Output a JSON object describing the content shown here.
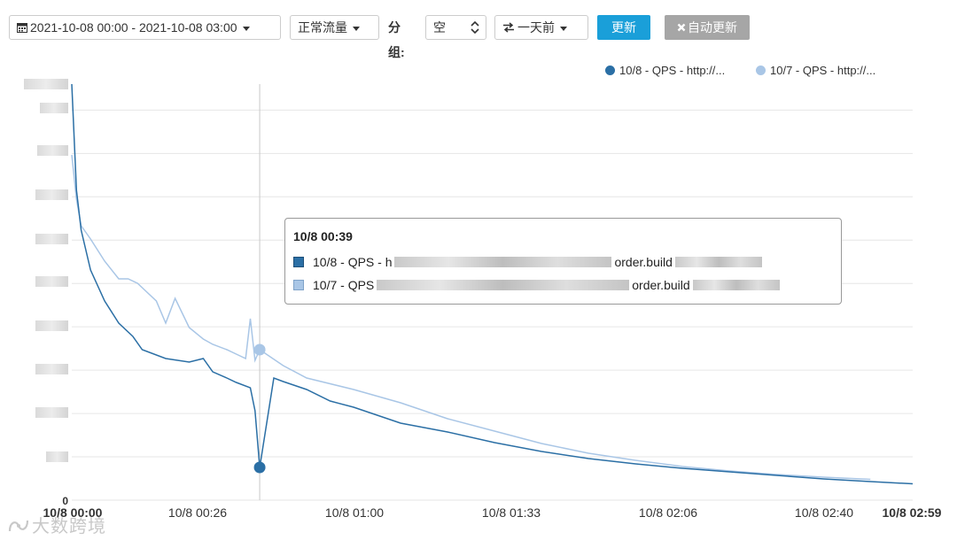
{
  "toolbar": {
    "date_range": "2021-10-08 00:00 - 2021-10-08 03:00",
    "traffic": "正常流量",
    "group_label": "分组:",
    "group_value": "空",
    "compare": "一天前",
    "update": "更新",
    "auto_update": "自动更新"
  },
  "icons": {
    "calendar": "calendar-icon",
    "swap": "swap-arrows-icon",
    "close": "close-icon",
    "select": "select-arrows-icon"
  },
  "colors": {
    "series_today": "#2b6fa5",
    "series_yesterday": "#a9c6e6",
    "button_primary": "#1a9fd9",
    "button_disabled": "#a6a6a6"
  },
  "watermark": "大数跨境",
  "tooltip": {
    "title": "10/8 00:39",
    "rows": [
      {
        "prefix": "10/8 - QPS - h",
        "suffix": "order.build"
      },
      {
        "prefix": "10/7 - QPS",
        "suffix": "order.build"
      }
    ]
  },
  "chart_data": {
    "type": "line",
    "legend_position": "top-right",
    "legend": [
      "10/8 - QPS - http://...",
      "10/7 - QPS - http://..."
    ],
    "x_tick_labels": [
      "10/8 00:00",
      "10/8 00:26",
      "10/8 01:00",
      "10/8 01:33",
      "10/8 02:06",
      "10/8 02:40",
      "10/8 02:59"
    ],
    "x_range_minutes": [
      0,
      179
    ],
    "y_tick_labels": [
      "0"
    ],
    "ylim": [
      0,
      4700
    ],
    "grid": true,
    "series": [
      {
        "name": "10/8 - QPS - http://...",
        "x_minutes": [
          0,
          1,
          2,
          4,
          7,
          10,
          13,
          15,
          20,
          25,
          28,
          30,
          33,
          35,
          38,
          39,
          40,
          43,
          45,
          50,
          55,
          60,
          65,
          70,
          80,
          90,
          100,
          110,
          120,
          130,
          140,
          150,
          160,
          170,
          179
        ],
        "values": [
          4700,
          3500,
          3050,
          2600,
          2250,
          2000,
          1850,
          1700,
          1600,
          1560,
          1600,
          1450,
          1380,
          1330,
          1270,
          1010,
          370,
          1380,
          1340,
          1250,
          1120,
          1050,
          960,
          870,
          770,
          650,
          550,
          470,
          410,
          360,
          320,
          280,
          240,
          210,
          185
        ]
      },
      {
        "name": "10/7 - QPS - http://...",
        "x_minutes": [
          0,
          1,
          2,
          4,
          7,
          10,
          12,
          14,
          16,
          18,
          20,
          22,
          25,
          28,
          30,
          33,
          35,
          37,
          38,
          39,
          40,
          45,
          50,
          60,
          70,
          80,
          90,
          100,
          110,
          120,
          130,
          140,
          150,
          160,
          170,
          179
        ],
        "values": [
          3900,
          3400,
          3100,
          2950,
          2700,
          2500,
          2500,
          2450,
          2350,
          2250,
          2000,
          2280,
          1950,
          1820,
          1760,
          1700,
          1650,
          1600,
          2050,
          1580,
          1700,
          1520,
          1380,
          1250,
          1100,
          920,
          780,
          640,
          530,
          450,
          380,
          330,
          290,
          260,
          235
        ]
      }
    ]
  }
}
